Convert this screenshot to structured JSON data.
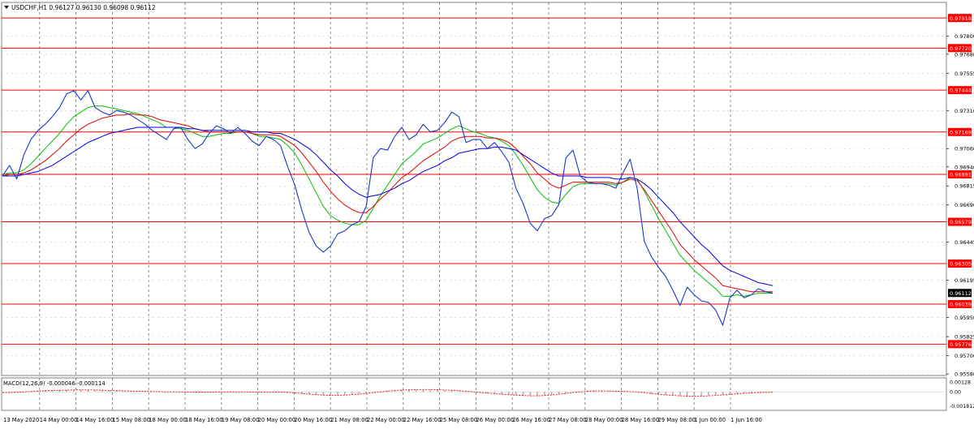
{
  "chart_data": {
    "type": "line",
    "title": "USDCHF,H1  0.96127 0.96130 0.96098 0.96112",
    "symbol": "USDCHF",
    "timeframe": "H1",
    "ohlc_header": {
      "open": 0.96127,
      "high": 0.9613,
      "low": 0.96098,
      "close": 0.96112
    },
    "grid": true,
    "ylim": [
      0.9557,
      0.9802
    ],
    "price_ticks": [
      "0.97800",
      "0.97680",
      "0.97555",
      "0.97310",
      "0.97060",
      "0.96940",
      "0.96815",
      "0.96690",
      "0.96445",
      "0.96195",
      "0.95950",
      "0.95825",
      "0.95700",
      "0.95580"
    ],
    "levels": [
      {
        "label": "0.97918",
        "value": 0.97918
      },
      {
        "label": "0.97720",
        "value": 0.9772
      },
      {
        "label": "0.97444",
        "value": 0.97444
      },
      {
        "label": "0.97169",
        "value": 0.97169
      },
      {
        "label": "0.96891",
        "value": 0.96891
      },
      {
        "label": "0.96579",
        "value": 0.96579
      },
      {
        "label": "0.96305",
        "value": 0.96305
      },
      {
        "label": "0.96039",
        "value": 0.96039
      },
      {
        "label": "0.95776",
        "value": 0.95776
      }
    ],
    "current_price_label": "0.96112",
    "current_price": 0.96112,
    "x_labels": [
      "13 May 2020",
      "14 May 00:00",
      "14 May 16:00",
      "15 May 08:00",
      "18 May 00:00",
      "18 May 16:00",
      "19 May 08:00",
      "20 May 00:00",
      "20 May 16:00",
      "21 May 08:00",
      "22 May 00:00",
      "22 May 16:00",
      "25 May 08:00",
      "26 May 00:00",
      "26 May 16:00",
      "27 May 08:00",
      "28 May 00:00",
      "28 May 16:00",
      "29 May 08:00",
      "1 Jun 00:00",
      "1 Jun 16:00"
    ],
    "price_series": {
      "name": "USDCHF",
      "values": [
        0.9688,
        0.9695,
        0.9686,
        0.9702,
        0.9712,
        0.9718,
        0.9722,
        0.9727,
        0.9733,
        0.9742,
        0.9744,
        0.9738,
        0.9744,
        0.9733,
        0.973,
        0.9728,
        0.9731,
        0.973,
        0.9728,
        0.9725,
        0.9722,
        0.9718,
        0.9715,
        0.9712,
        0.9719,
        0.972,
        0.9712,
        0.9706,
        0.9709,
        0.9716,
        0.9721,
        0.9719,
        0.9716,
        0.972,
        0.9716,
        0.9711,
        0.9708,
        0.9714,
        0.9712,
        0.9708,
        0.9694,
        0.9682,
        0.9665,
        0.9651,
        0.9642,
        0.9638,
        0.9642,
        0.965,
        0.9652,
        0.9656,
        0.9658,
        0.9668,
        0.97,
        0.9706,
        0.9705,
        0.9714,
        0.972,
        0.9712,
        0.9715,
        0.9722,
        0.9717,
        0.9718,
        0.9723,
        0.973,
        0.9727,
        0.971,
        0.9712,
        0.9712,
        0.9706,
        0.971,
        0.9704,
        0.9697,
        0.968,
        0.967,
        0.9657,
        0.9652,
        0.966,
        0.9662,
        0.9669,
        0.97,
        0.9705,
        0.9688,
        0.9684,
        0.9683,
        0.9683,
        0.9682,
        0.968,
        0.969,
        0.9699,
        0.968,
        0.9645,
        0.9635,
        0.9628,
        0.9622,
        0.9613,
        0.9603,
        0.9615,
        0.961,
        0.9606,
        0.9605,
        0.96,
        0.959,
        0.9608,
        0.9613,
        0.9608,
        0.961,
        0.9614,
        0.9612,
        0.9611
      ]
    },
    "ma_series": [
      {
        "color": "#00c000",
        "values": [
          0.9689,
          0.969,
          0.969,
          0.9692,
          0.9696,
          0.9701,
          0.9706,
          0.9711,
          0.9716,
          0.9722,
          0.9727,
          0.973,
          0.9733,
          0.9734,
          0.9734,
          0.9733,
          0.9732,
          0.9731,
          0.973,
          0.9729,
          0.9727,
          0.9725,
          0.9723,
          0.972,
          0.972,
          0.9719,
          0.9718,
          0.9716,
          0.9714,
          0.9714,
          0.9715,
          0.9716,
          0.9716,
          0.9717,
          0.9717,
          0.9716,
          0.9714,
          0.9714,
          0.9713,
          0.9712,
          0.9708,
          0.9703,
          0.9695,
          0.9686,
          0.9677,
          0.9668,
          0.9662,
          0.9659,
          0.9657,
          0.9656,
          0.9656,
          0.9659,
          0.9667,
          0.9675,
          0.9682,
          0.9689,
          0.9696,
          0.97,
          0.9704,
          0.9709,
          0.9711,
          0.9713,
          0.9716,
          0.9719,
          0.9721,
          0.9719,
          0.9717,
          0.9716,
          0.9714,
          0.9713,
          0.9711,
          0.9708,
          0.9702,
          0.9695,
          0.9687,
          0.9679,
          0.9674,
          0.9671,
          0.967,
          0.9676,
          0.9681,
          0.9683,
          0.9683,
          0.9683,
          0.9683,
          0.9683,
          0.9682,
          0.9684,
          0.9687,
          0.9686,
          0.9678,
          0.9669,
          0.966,
          0.9652,
          0.9644,
          0.9636,
          0.9631,
          0.9626,
          0.9622,
          0.9618,
          0.9614,
          0.9609,
          0.9609,
          0.961,
          0.9609,
          0.961,
          0.9611,
          0.9611,
          0.9611
        ]
      },
      {
        "color": "#e00000",
        "values": [
          0.9688,
          0.9689,
          0.9689,
          0.969,
          0.9692,
          0.9695,
          0.9698,
          0.9702,
          0.9706,
          0.9711,
          0.9715,
          0.9719,
          0.9722,
          0.9724,
          0.9726,
          0.9727,
          0.9728,
          0.9728,
          0.9729,
          0.9728,
          0.9728,
          0.9727,
          0.9725,
          0.9724,
          0.9723,
          0.9722,
          0.9721,
          0.9719,
          0.9718,
          0.9717,
          0.9717,
          0.9717,
          0.9717,
          0.9717,
          0.9717,
          0.9716,
          0.9715,
          0.9715,
          0.9715,
          0.9714,
          0.9711,
          0.9708,
          0.9703,
          0.9697,
          0.9691,
          0.9684,
          0.9678,
          0.9673,
          0.9669,
          0.9666,
          0.9664,
          0.9664,
          0.9668,
          0.9673,
          0.9677,
          0.9682,
          0.9687,
          0.969,
          0.9694,
          0.9698,
          0.9701,
          0.9704,
          0.9707,
          0.9711,
          0.9713,
          0.9714,
          0.9714,
          0.9714,
          0.9713,
          0.9713,
          0.9712,
          0.971,
          0.9706,
          0.9701,
          0.9696,
          0.969,
          0.9686,
          0.9682,
          0.968,
          0.9682,
          0.9684,
          0.9684,
          0.9684,
          0.9684,
          0.9684,
          0.9684,
          0.9683,
          0.9684,
          0.9686,
          0.9685,
          0.9679,
          0.9672,
          0.9665,
          0.9658,
          0.9651,
          0.9643,
          0.9638,
          0.9633,
          0.9629,
          0.9625,
          0.9621,
          0.9616,
          0.9615,
          0.9614,
          0.9613,
          0.9612,
          0.9612,
          0.9612,
          0.9612
        ]
      },
      {
        "color": "#0000e0",
        "values": [
          0.9688,
          0.9688,
          0.9688,
          0.9689,
          0.969,
          0.9691,
          0.9693,
          0.9695,
          0.9698,
          0.9701,
          0.9704,
          0.9707,
          0.971,
          0.9712,
          0.9714,
          0.9716,
          0.9717,
          0.9718,
          0.9719,
          0.972,
          0.972,
          0.972,
          0.972,
          0.972,
          0.972,
          0.972,
          0.9719,
          0.9719,
          0.9718,
          0.9718,
          0.9718,
          0.9718,
          0.9718,
          0.9718,
          0.9718,
          0.9717,
          0.9717,
          0.9717,
          0.9716,
          0.9716,
          0.9714,
          0.9712,
          0.9709,
          0.9706,
          0.9702,
          0.9697,
          0.9692,
          0.9688,
          0.9683,
          0.9679,
          0.9676,
          0.9674,
          0.9675,
          0.9676,
          0.9678,
          0.968,
          0.9683,
          0.9685,
          0.9688,
          0.9691,
          0.9693,
          0.9695,
          0.9698,
          0.97,
          0.9703,
          0.9704,
          0.9705,
          0.9706,
          0.9706,
          0.9707,
          0.9707,
          0.9706,
          0.9705,
          0.9702,
          0.9699,
          0.9696,
          0.9693,
          0.969,
          0.9688,
          0.9688,
          0.9688,
          0.9688,
          0.9687,
          0.9687,
          0.9687,
          0.9687,
          0.9686,
          0.9686,
          0.9687,
          0.9686,
          0.9683,
          0.9679,
          0.9674,
          0.9669,
          0.9664,
          0.9658,
          0.9653,
          0.9648,
          0.9643,
          0.9639,
          0.9634,
          0.9629,
          0.9626,
          0.9624,
          0.9622,
          0.962,
          0.9618,
          0.9617,
          0.9616
        ]
      }
    ],
    "macd": {
      "label": "MACD(12,26,9) -0.000046 -0.000114",
      "ticks": [
        "0.00128",
        "0.00",
        "-0.001812"
      ],
      "ylim": [
        -0.0022,
        0.0016
      ],
      "histogram": [
        -0.00012,
        -8e-05,
        -4e-05,
        2e-05,
        8e-05,
        0.00014,
        0.00018,
        0.0002,
        0.00022,
        0.00024,
        0.00026,
        0.00026,
        0.00024,
        0.00022,
        0.00018,
        0.00015,
        0.00012,
        0.0001,
        8e-05,
        6e-05,
        4e-05,
        2e-05,
        0.0,
        -2e-05,
        -2e-05,
        -3e-05,
        -4e-05,
        -5e-05,
        -4e-05,
        -3e-05,
        -2e-05,
        -2e-05,
        -2e-05,
        -2e-05,
        -2e-05,
        -3e-05,
        -3e-05,
        -3e-05,
        -3e-05,
        -4e-05,
        -0.0001,
        -0.00018,
        -0.00026,
        -0.00034,
        -0.0004,
        -0.00046,
        -0.00048,
        -0.00046,
        -0.0004,
        -0.00034,
        -0.00026,
        -0.00018,
        -6e-05,
        6e-05,
        0.00014,
        0.0002,
        0.00026,
        0.00028,
        0.0003,
        0.00032,
        0.0003,
        0.00026,
        0.00022,
        0.00018,
        0.00012,
        4e-05,
        -4e-05,
        -0.00012,
        -0.0002,
        -0.00028,
        -0.00034,
        -0.0004,
        -0.00046,
        -0.0005,
        -0.00052,
        -0.00052,
        -0.00046,
        -0.00038,
        -0.00028,
        -0.00016,
        -6e-05,
        4e-05,
        0.0001,
        0.00012,
        0.00012,
        0.0001,
        8e-05,
        4e-05,
        2e-05,
        -4e-05,
        -0.00014,
        -0.00026,
        -0.00036,
        -0.00044,
        -0.0005,
        -0.00054,
        -0.00056,
        -0.00056,
        -0.00054,
        -0.0005,
        -0.00044,
        -0.00038,
        -0.0003,
        -0.00022,
        -0.00016,
        -0.00012,
        -8e-05,
        -6e-05,
        -5e-05
      ],
      "signal": [
        -0.0001,
        -9e-05,
        -6e-05,
        -2e-05,
        4e-05,
        0.0001,
        0.00014,
        0.00017,
        0.0002,
        0.00022,
        0.00024,
        0.00025,
        0.00025,
        0.00024,
        0.00021,
        0.00018,
        0.00015,
        0.00012,
        0.0001,
        8e-05,
        6e-05,
        4e-05,
        2e-05,
        0.0,
        -1e-05,
        -2e-05,
        -3e-05,
        -4e-05,
        -4e-05,
        -3e-05,
        -3e-05,
        -2e-05,
        -2e-05,
        -2e-05,
        -2e-05,
        -3e-05,
        -3e-05,
        -3e-05,
        -3e-05,
        -3e-05,
        -7e-05,
        -0.00014,
        -0.00022,
        -0.0003,
        -0.00037,
        -0.00043,
        -0.00047,
        -0.00047,
        -0.00043,
        -0.00037,
        -0.0003,
        -0.00022,
        -0.00011,
        0.0,
        9e-05,
        0.00016,
        0.00022,
        0.00026,
        0.00028,
        0.0003,
        0.0003,
        0.00028,
        0.00024,
        0.0002,
        0.00015,
        8e-05,
        0.0,
        -8e-05,
        -0.00016,
        -0.00024,
        -0.00031,
        -0.00037,
        -0.00043,
        -0.00048,
        -0.00051,
        -0.00052,
        -0.00048,
        -0.00041,
        -0.00032,
        -0.00021,
        -0.0001,
        0.0,
        7e-05,
        0.00011,
        0.00012,
        0.00011,
        9e-05,
        6e-05,
        3e-05,
        -2e-05,
        -0.0001,
        -0.00021,
        -0.00031,
        -0.0004,
        -0.00047,
        -0.00052,
        -0.00055,
        -0.00056,
        -0.00055,
        -0.00052,
        -0.00047,
        -0.00041,
        -0.00034,
        -0.00026,
        -0.00019,
        -0.00014,
        -0.0001,
        -7e-05,
        -5e-05
      ]
    }
  },
  "colors": {
    "background": "#ffffff",
    "grid": "#b0b0b0",
    "level_line": "#ff0000",
    "price_line": "#1a36c8",
    "macd_hist": "#b0b0b0",
    "macd_signal": "#ff0000",
    "current_tag": "#000000"
  },
  "icons": {
    "header": "triangle-down-icon"
  }
}
